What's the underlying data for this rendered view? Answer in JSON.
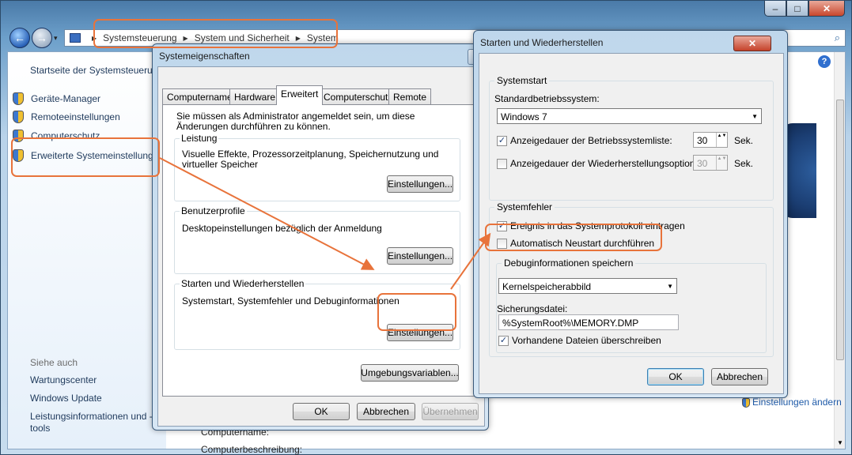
{
  "window": {
    "caption": {
      "minimize": "–",
      "maximize": "□",
      "close": "✕"
    },
    "nav": {
      "back": "←",
      "forward": "→",
      "history": "▾"
    },
    "breadcrumb": [
      "Systemsteuerung",
      "System und Sicherheit",
      "System"
    ],
    "breadcrumb_sep": "▶",
    "search_icon": "⌕"
  },
  "left_pane": {
    "home": "Startseite der Systemsteuerung",
    "items": [
      "Geräte-Manager",
      "Remoteeinstellungen",
      "Computerschutz",
      "Erweiterte Systemeinstellungen"
    ],
    "see_also_heading": "Siehe auch",
    "see_also": [
      "Wartungscenter",
      "Windows Update",
      "Leistungsinformationen und -tools"
    ]
  },
  "main": {
    "help": "?",
    "change_settings": "Einstellungen ändern",
    "bottom_labels": [
      "Computername:",
      "Computerbeschreibung:"
    ]
  },
  "sysprops": {
    "title": "Systemeigenschaften",
    "close": "✕",
    "tabs": [
      "Computername",
      "Hardware",
      "Erweitert",
      "Computerschutz",
      "Remote"
    ],
    "active_tab": "Erweitert",
    "admin_note": "Sie müssen als Administrator angemeldet sein, um diese Änderungen durchführen zu können.",
    "groups": [
      {
        "title": "Leistung",
        "desc": "Visuelle Effekte, Prozessorzeitplanung, Speichernutzung und virtueller Speicher",
        "button": "Einstellungen..."
      },
      {
        "title": "Benutzerprofile",
        "desc": "Desktopeinstellungen bezüglich der Anmeldung",
        "button": "Einstellungen..."
      },
      {
        "title": "Starten und Wiederherstellen",
        "desc": "Systemstart, Systemfehler und Debuginformationen",
        "button": "Einstellungen..."
      }
    ],
    "env_button": "Umgebungsvariablen...",
    "ok": "OK",
    "cancel": "Abbrechen",
    "apply": "Übernehmen"
  },
  "startup": {
    "title": "Starten und Wiederherstellen",
    "close": "✕",
    "systemstart_label": "Systemstart",
    "default_os_label": "Standardbetriebssystem:",
    "default_os_value": "Windows 7",
    "show_os_list": {
      "label": "Anzeigedauer der Betriebssystemliste:",
      "checked": true,
      "value": "30",
      "unit": "Sek."
    },
    "show_recovery": {
      "label": "Anzeigedauer der Wiederherstellungsoptionen:",
      "checked": false,
      "value": "30",
      "unit": "Sek."
    },
    "systemfehler_label": "Systemfehler",
    "write_event": {
      "label": "Ereignis in das Systemprotokoll eintragen",
      "checked": true
    },
    "auto_restart": {
      "label": "Automatisch Neustart durchführen",
      "checked": false
    },
    "debug_label": "Debuginformationen speichern",
    "debug_value": "Kernelspeicherabbild",
    "dump_file_label": "Sicherungsdatei:",
    "dump_file_value": "%SystemRoot%\\MEMORY.DMP",
    "overwrite": {
      "label": "Vorhandene Dateien überschreiben",
      "checked": true
    },
    "ok": "OK",
    "cancel": "Abbrechen",
    "check_mark": "✓",
    "combo_arrow": "▼",
    "spin_arrows": "▲▼"
  },
  "accent_color": "#e8733b"
}
